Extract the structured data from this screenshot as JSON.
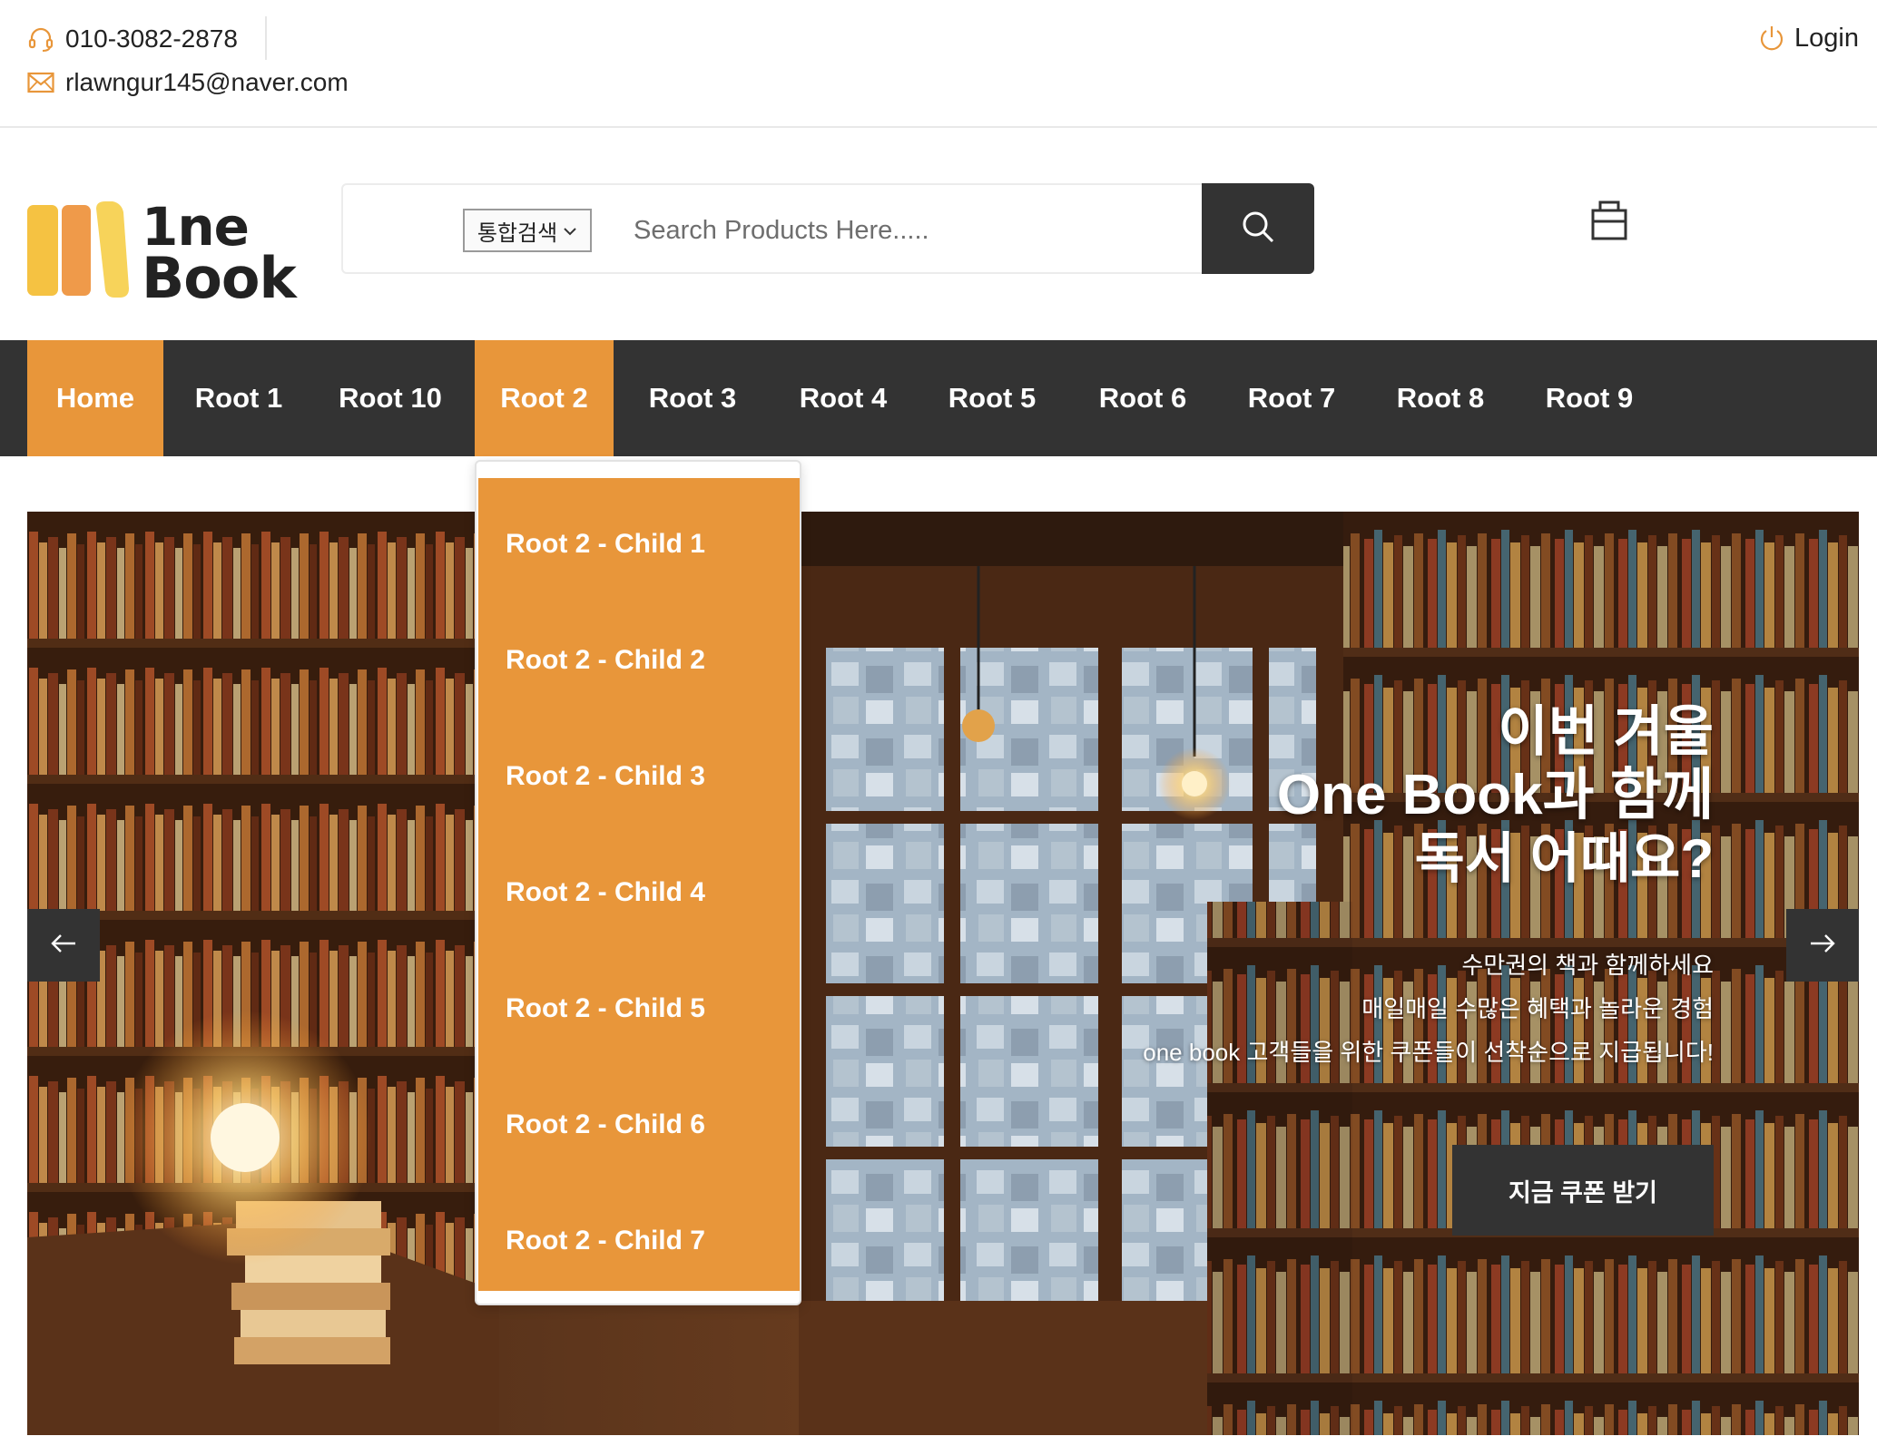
{
  "topbar": {
    "phone": "010-3082-2878",
    "email": "rlawngur145@naver.com",
    "login_label": "Login",
    "phone_icon": "headset-icon",
    "email_icon": "envelope-icon",
    "login_icon": "power-icon"
  },
  "header": {
    "logo_line1": "1ne",
    "logo_line2": "Book",
    "search": {
      "category_selected": "통합검색",
      "placeholder": "Search Products Here.....",
      "button_icon": "search-icon"
    },
    "cart_icon": "shopping-bag-icon"
  },
  "nav": {
    "items": [
      {
        "label": "Home",
        "active": true
      },
      {
        "label": "Root 1"
      },
      {
        "label": "Root 10"
      },
      {
        "label": "Root 2",
        "active": true
      },
      {
        "label": "Root 3"
      },
      {
        "label": "Root 4"
      },
      {
        "label": "Root 5"
      },
      {
        "label": "Root 6"
      },
      {
        "label": "Root 7"
      },
      {
        "label": "Root 8"
      },
      {
        "label": "Root 9"
      }
    ]
  },
  "dropdown": {
    "items": [
      "Root 2 - Child 1",
      "Root 2 - Child 2",
      "Root 2 - Child 3",
      "Root 2 - Child 4",
      "Root 2 - Child 5",
      "Root 2 - Child 6",
      "Root 2 - Child 7"
    ]
  },
  "hero": {
    "title_line1": "이번 겨울",
    "title_line2": "One Book과 함께",
    "title_line3": "독서 어때요?",
    "sub_line1": "수만권의 책과 함께하세요",
    "sub_line2": "매일매일 수많은 혜택과 놀라운 경험",
    "sub_line3": "one book 고객들을 위한 쿠폰들이 선착순으로 지급됩니다!",
    "cta_label": "지금 쿠폰 받기",
    "prev_icon": "arrow-left-icon",
    "next_icon": "arrow-right-icon"
  },
  "colors": {
    "accent": "#e8963a",
    "dark": "#333333",
    "white": "#ffffff",
    "logo_yellow": "#f5c242",
    "logo_orange": "#ef9a4a"
  }
}
